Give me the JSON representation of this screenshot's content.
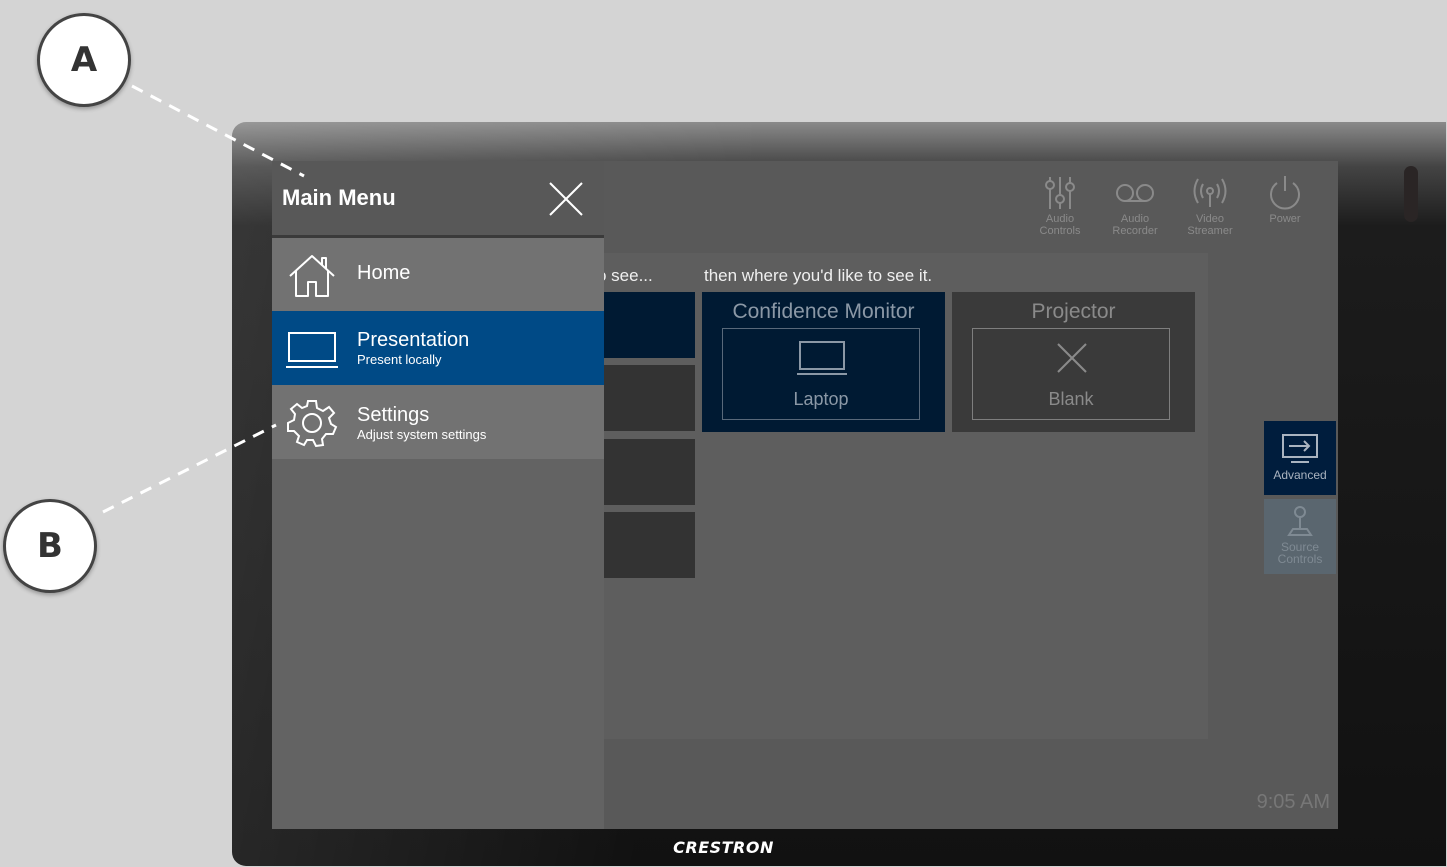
{
  "callouts": {
    "a": "A",
    "b": "B"
  },
  "brand": "CRESTRON",
  "menu": {
    "title": "Main Menu",
    "items": [
      {
        "label": "Home",
        "sublabel": "",
        "icon": "home-icon"
      },
      {
        "label": "Presentation",
        "sublabel": "Present locally",
        "icon": "laptop-icon",
        "active": true
      },
      {
        "label": "Settings",
        "sublabel": "Adjust system settings",
        "icon": "gear-icon"
      }
    ]
  },
  "toolbar": {
    "audio_controls": "Audio Controls",
    "audio_recorder": "Audio Recorder",
    "video_streamer": "Video Streamer",
    "power": "Power"
  },
  "content": {
    "prompt_left": "o see...",
    "prompt_right": "then where you'd like to see it.",
    "destinations": [
      {
        "title": "Confidence Monitor",
        "source": "Laptop"
      },
      {
        "title": "Projector",
        "source": "Blank"
      }
    ]
  },
  "side": {
    "advanced": "Advanced",
    "source_controls": "Source Controls"
  },
  "clock": "9:05 AM",
  "colors": {
    "accent": "#004a86",
    "menu": "#636363",
    "menu_item": "#727272",
    "overlay": "#595959"
  }
}
